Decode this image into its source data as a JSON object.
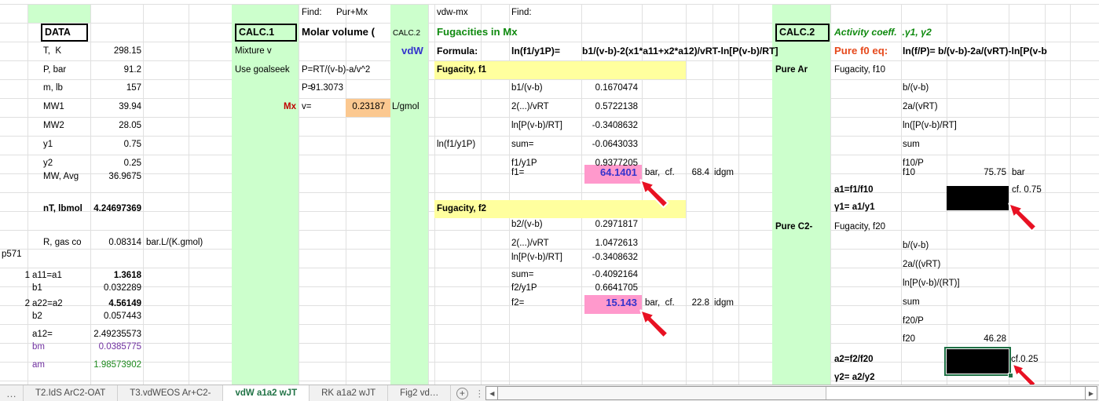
{
  "colors": {
    "band_green": "#ccffcc",
    "band_yellow": "#ffff9e",
    "cell_pink": "#ff99cc",
    "cell_orange": "#fbc890",
    "value_blue": "#3333cc",
    "title_green": "#0f8a0f",
    "accent_red": "#e6491c",
    "mx_red": "#c00000",
    "purple": "#7030a0",
    "value_green": "#1e8a1e",
    "tab_green": "#217346",
    "arrow_red": "#e81123"
  },
  "data_block": {
    "header": "DATA",
    "page_ref": "p571",
    "rows": [
      {
        "label": "T,  K",
        "value": "298.15"
      },
      {
        "label": "P, bar",
        "value": "91.2"
      },
      {
        "label": "m, lb",
        "value": "157"
      },
      {
        "label": "MW1",
        "value": "39.94"
      },
      {
        "label": "MW2",
        "value": "28.05"
      },
      {
        "label": "y1",
        "value": "0.75"
      },
      {
        "label": "y2",
        "value": "0.25"
      },
      {
        "label": "MW, Avg",
        "value": "36.9675"
      },
      {
        "label": "nT, lbmol",
        "value": "4.24697369"
      },
      {
        "label": "R, gas co",
        "value": "0.08314",
        "unit": "bar.L/(K.gmol)"
      }
    ],
    "params": [
      {
        "num": "1",
        "label": "a11=a1",
        "value": "1.3618"
      },
      {
        "num": "",
        "label": "b1",
        "value": "0.032289"
      },
      {
        "num": "2",
        "label": "a22=a2",
        "value": "4.56149"
      },
      {
        "num": "",
        "label": "b2",
        "value": "0.057443"
      },
      {
        "num": "",
        "label": "a12=",
        "value": "2.49235573"
      },
      {
        "num": "",
        "label": "bm",
        "value": "0.0385775"
      },
      {
        "num": "",
        "label": "am",
        "value": "1.98573902"
      }
    ]
  },
  "calc1": {
    "header": "CALC.1",
    "row1": "Mixture v",
    "row2": "Use goalseek",
    "mx": "Mx"
  },
  "molar": {
    "find_label": "Find:",
    "find_value": "Pur+Mx",
    "title": "Molar volume (",
    "calc2_note": "CALC.2",
    "vdw": "vdW",
    "eq": "P=RT/(v-b)-a/v^2",
    "p_label": "P=",
    "p_value": "91.3073",
    "v_label": "v=",
    "v_value": "0.23187",
    "v_unit": "L/gmol"
  },
  "fug": {
    "ref": "vdw-mx",
    "find": "Find:",
    "title": "Fugacities in Mx",
    "formula_label": "Formula:",
    "lhs": "ln(f1/y1P)=",
    "rhs": "b1/(v-b)-2(x1*a11+x2*a12)/vRT-ln[P(v-b)/RT]",
    "f1": {
      "band": "Fugacity, f1",
      "r1l": "b1/(v-b)",
      "r1v": "0.1670474",
      "r2l": "2(...)/vRT",
      "r2v": "0.5722138",
      "r3l": "ln[P(v-b)/RT]",
      "r3v": "-0.3408632",
      "sum_side": "ln(f1/y1P)",
      "r4l": "sum=",
      "r4v": "-0.0643033",
      "r5l": "f1/y1P",
      "r5v": "0.9377205",
      "res_l": "f1=",
      "res_v": "64.1401",
      "res_u": "bar,  cf.",
      "cmp_v": "68.4",
      "cmp_u": "idgm"
    },
    "f2": {
      "band": "Fugacity, f2",
      "r1l": "b2/(v-b)",
      "r1v": "0.2971817",
      "r2l": "2(...)/vRT",
      "r2v": "1.0472613",
      "r3l": "ln[P(v-b)/RT]",
      "r3v": "-0.3408632",
      "r4l": "sum=",
      "r4v": "-0.4092164",
      "r5l": "f2/y1P",
      "r5v": "0.6641705",
      "res_l": "f2=",
      "res_v": "15.143",
      "res_u": "bar,  cf.",
      "cmp_v": "22.8",
      "cmp_u": "idgm"
    }
  },
  "calc2": {
    "header": "CALC.2",
    "pure1": "Pure Ar",
    "pure2": "Pure C2-"
  },
  "act": {
    "title": "Activity coeff.  .γ1, γ2",
    "eq_label": "Pure f0 eq:",
    "eq_rhs": "ln(f/P)= b/(v-b)-2a/(vRT)-ln[P(v-b",
    "f10": {
      "header": "Fugacity, f10",
      "l1": "b/(v-b)",
      "l2": "2a/(vRT)",
      "l3": "ln([P(v-b)/RT]",
      "l4": "sum",
      "l5": "f10/P",
      "res_l": "f10",
      "res_v": "75.75",
      "res_u": "bar",
      "a": "a1=f1/f10",
      "cf": "cf. 0.75",
      "gamma": "γ1= a1/y1"
    },
    "f20": {
      "header": "Fugacity, f20",
      "l1": "b/(v-b)",
      "l2": "2a/((vRT)",
      "l3": "ln[P(v-b)/(RT)]",
      "l4": "sum",
      "l5": "f20/P",
      "res_l": "f20",
      "res_v": "46.28",
      "a": "a2=f2/f20",
      "cf": "cf.0.25",
      "gamma": "γ2= a2/y2"
    }
  },
  "tabs": {
    "overflow": "…",
    "items": [
      {
        "label": "T2.IdS ArC2-OAT"
      },
      {
        "label": "T3.vdWEOS Ar+C2-"
      },
      {
        "label": "vdW a1a2 wJT"
      },
      {
        "label": "RK a1a2 wJT"
      },
      {
        "label": "Fig2 vd…"
      }
    ],
    "add": "+",
    "splitter": "⋮",
    "scroll_left": "◀",
    "scroll_right": "▶"
  }
}
